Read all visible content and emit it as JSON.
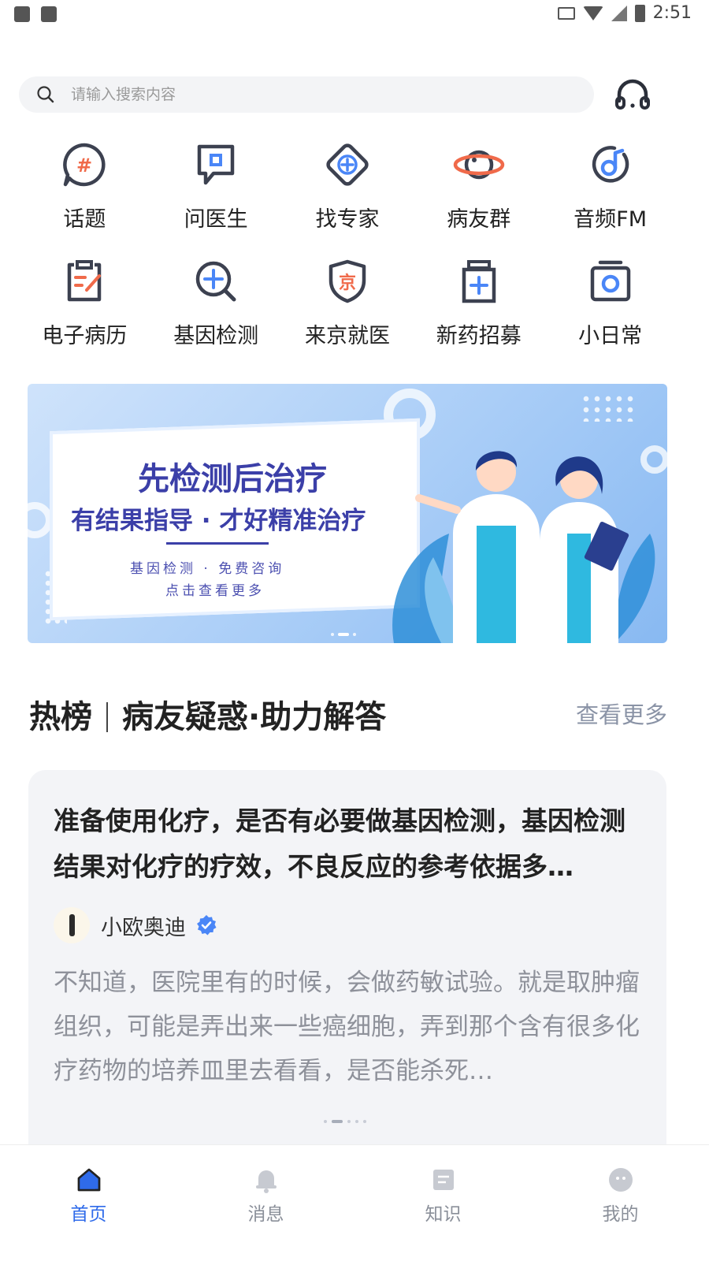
{
  "status_bar": {
    "time": "2:51"
  },
  "search": {
    "placeholder": "请输入搜索内容"
  },
  "shortcuts": [
    {
      "label": "话题",
      "icon": "topic-icon"
    },
    {
      "label": "问医生",
      "icon": "ask-doctor-icon"
    },
    {
      "label": "找专家",
      "icon": "find-expert-icon"
    },
    {
      "label": "病友群",
      "icon": "patient-group-icon"
    },
    {
      "label": "音频FM",
      "icon": "audio-fm-icon"
    },
    {
      "label": "电子病历",
      "icon": "medical-record-icon"
    },
    {
      "label": "基因检测",
      "icon": "gene-test-icon"
    },
    {
      "label": "来京就医",
      "icon": "beijing-medical-icon"
    },
    {
      "label": "新药招募",
      "icon": "new-drug-icon"
    },
    {
      "label": "小日常",
      "icon": "daily-icon"
    }
  ],
  "banner": {
    "title": "先检测后治疗",
    "subtitle": "有结果指导 · 才好精准治疗",
    "line1": "基因检测 · 免费咨询",
    "line2": "点击查看更多",
    "jing_char": "京"
  },
  "hot": {
    "title_left": "热榜",
    "title_right": "病友疑惑·助力解答",
    "more": "查看更多",
    "question": "准备使用化疗，是否有必要做基因检测，基因检测结果对化疗的疗效，不良反应的参考依据多…",
    "author": "小欧奥迪",
    "answer": "不知道，医院里有的时候，会做药敏试验。就是取肿瘤组织，可能是弄出来一些癌细胞，弄到那个含有很多化疗药物的培养皿里去看看，是否能杀死…"
  },
  "tabs": [
    {
      "label": "首页",
      "icon": "home-icon"
    },
    {
      "label": "消息",
      "icon": "bell-icon"
    },
    {
      "label": "知识",
      "icon": "knowledge-icon"
    },
    {
      "label": "我的",
      "icon": "profile-icon"
    }
  ],
  "colors": {
    "accent": "#2f6bea",
    "icon_orange": "#f06a4a",
    "icon_blue": "#4a86f7",
    "icon_dark": "#3c4150",
    "banner_text": "#3b3fa8"
  }
}
